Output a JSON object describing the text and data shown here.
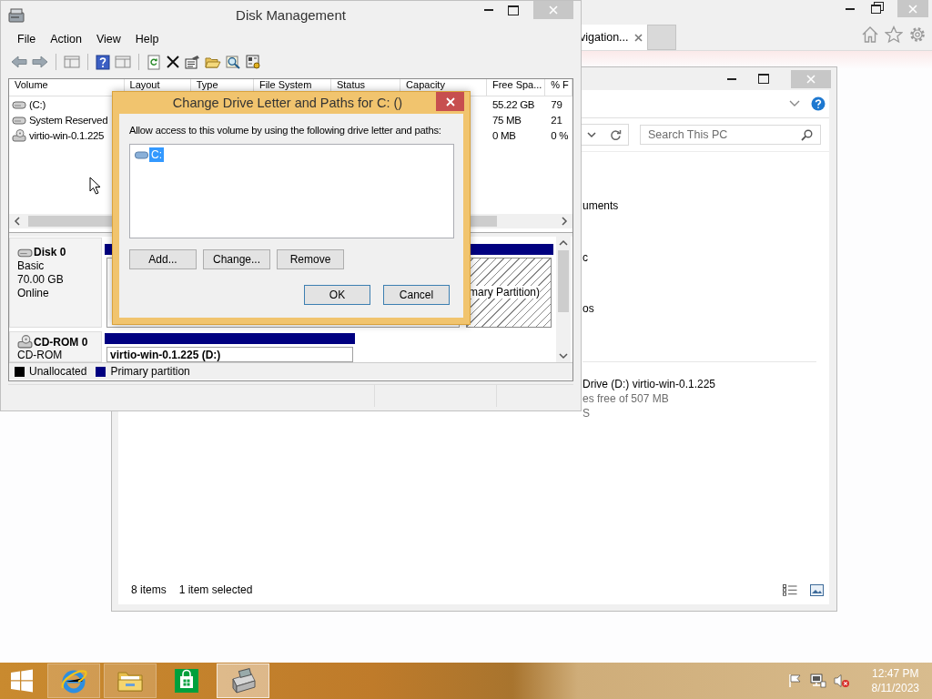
{
  "browser": {
    "tabs": [
      {
        "label": "vigation..."
      }
    ]
  },
  "explorer": {
    "search": {
      "placeholder": "Search This PC"
    },
    "folders": [
      "uments",
      "c",
      "os"
    ],
    "drive": {
      "name": "Drive (D:) virtio-win-0.1.225",
      "space": "es free of 507 MB",
      "filesystem": "S"
    },
    "status": {
      "count": "8 items",
      "selection": "1 item selected"
    }
  },
  "disk_management": {
    "title": "Disk Management",
    "menu": [
      "File",
      "Action",
      "View",
      "Help"
    ],
    "columns": [
      "Volume",
      "Layout",
      "Type",
      "File System",
      "Status",
      "Capacity",
      "Free Spa...",
      "% F"
    ],
    "volumes": [
      {
        "kind": "disk",
        "name": "(C:)",
        "free": "55.22 GB",
        "percent": "79"
      },
      {
        "kind": "disk",
        "name": "System Reserved",
        "free": "75 MB",
        "percent": "21"
      },
      {
        "kind": "cdrom",
        "name": "virtio-win-0.1.225",
        "free": "0 MB",
        "percent": "0 %"
      }
    ],
    "disks": [
      {
        "kind": "disk",
        "name": "Disk 0",
        "details": [
          "Basic",
          "70.00 GB",
          "Online"
        ],
        "partitions": [
          {
            "selected": false
          },
          {
            "label": "mary Partition)",
            "selected": true
          }
        ]
      },
      {
        "kind": "cdrom",
        "name": "CD-ROM 0",
        "details": [
          "CD-ROM"
        ],
        "partitions": [
          {
            "label": "virtio-win-0.1.225  (D:)",
            "selected": false
          }
        ]
      }
    ],
    "legend": [
      {
        "label": "Unallocated",
        "color": "#000000"
      },
      {
        "label": "Primary partition",
        "color": "#000080"
      }
    ]
  },
  "dialog": {
    "title": "Change Drive Letter and Paths for C: ()",
    "prompt": "Allow access to this volume by using the following drive letter and paths:",
    "paths": [
      {
        "label": "C:",
        "selected": true
      }
    ],
    "actions": [
      "Add...",
      "Change...",
      "Remove"
    ],
    "buttons": [
      "OK",
      "Cancel"
    ]
  },
  "taskbar": {
    "apps": [
      {
        "kind": "ie",
        "running": true,
        "selected": false
      },
      {
        "kind": "explorer",
        "running": true,
        "selected": false
      },
      {
        "kind": "store",
        "running": false,
        "selected": false
      },
      {
        "kind": "disk-management",
        "running": true,
        "selected": true
      }
    ],
    "volume_muted": true,
    "clock": {
      "time": "12:47 PM",
      "date": "8/11/2023"
    }
  }
}
